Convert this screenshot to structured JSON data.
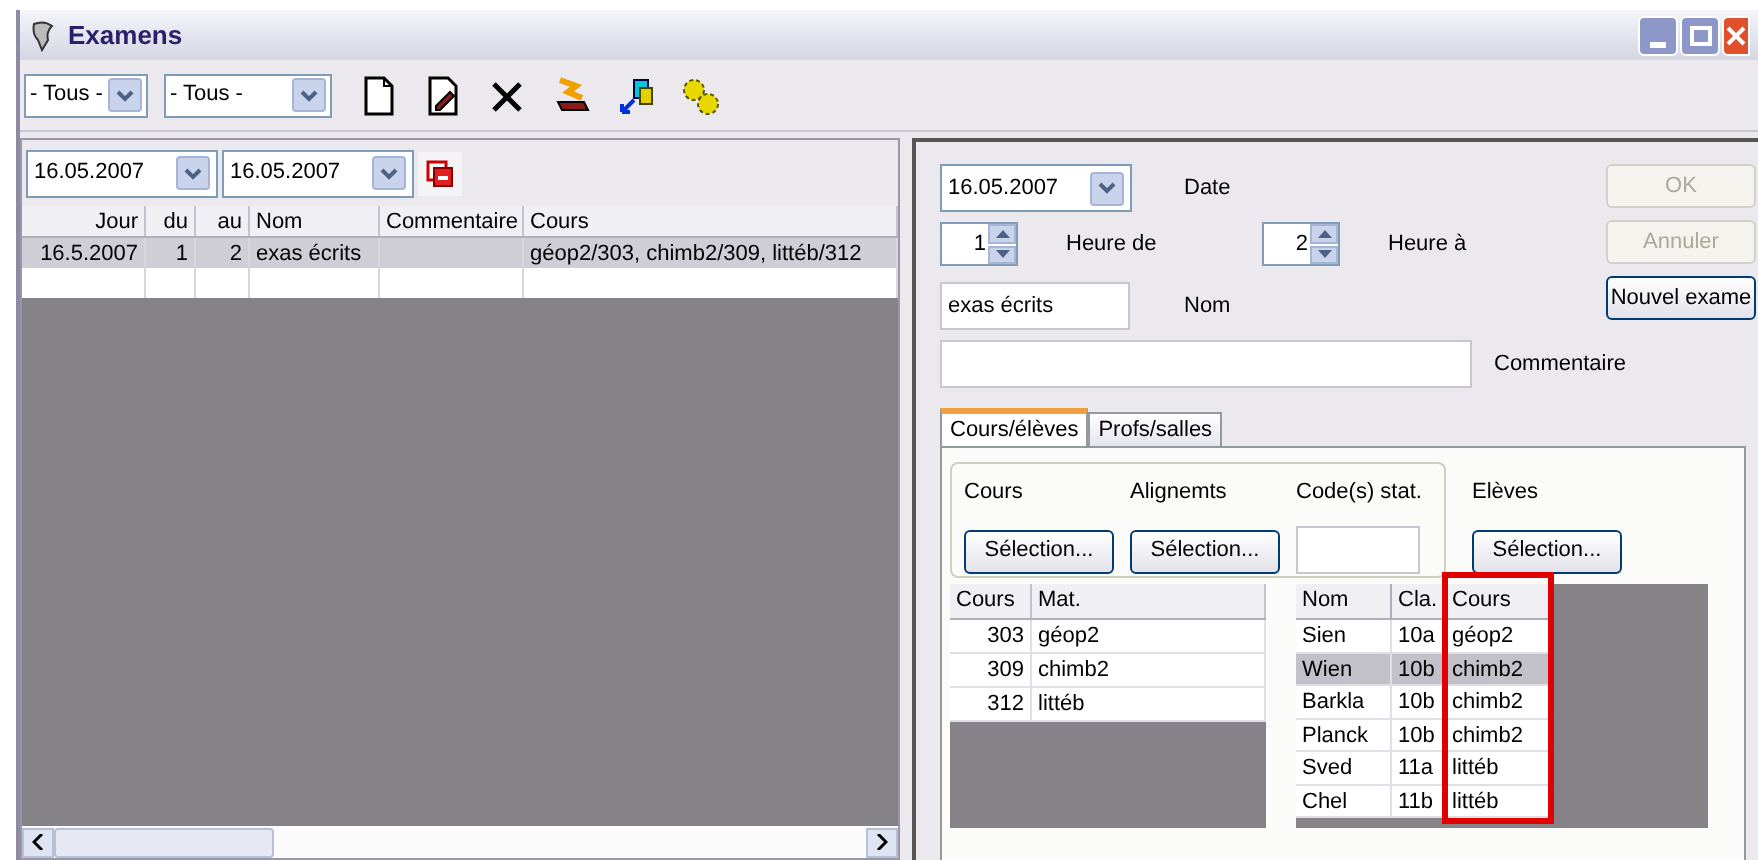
{
  "window": {
    "title": "Examens"
  },
  "toolbar": {
    "filters": [
      {
        "value": "- Tous -"
      },
      {
        "value": "- Tous -"
      }
    ]
  },
  "left": {
    "date_from": "16.05.2007",
    "date_to": "16.05.2007",
    "columns": [
      "Jour",
      "du",
      "au",
      "Nom",
      "Commentaire",
      "Cours"
    ],
    "rows": [
      {
        "cells": [
          "16.5.2007",
          "1",
          "2",
          "exas écrits",
          "",
          "géop2/303, chimb2/309, littéb/312"
        ],
        "selected": true
      }
    ]
  },
  "form": {
    "date": "16.05.2007",
    "date_label": "Date",
    "hour_from": "1",
    "hour_from_label": "Heure de",
    "hour_to": "2",
    "hour_to_label": "Heure à",
    "name": "exas écrits",
    "name_label": "Nom",
    "comment_label": "Commentaire",
    "buttons": [
      {
        "label": "OK",
        "disabled": true
      },
      {
        "label": "Annuler",
        "disabled": true
      },
      {
        "label": "Nouvel exame",
        "disabled": false
      }
    ]
  },
  "tabs": [
    {
      "label": "Cours/élèves",
      "selected": true
    },
    {
      "label": "Profs/salles",
      "selected": false
    }
  ],
  "selection": {
    "groups": [
      {
        "label": "Cours",
        "kind": "button",
        "button": "Sélection..."
      },
      {
        "label": "Alignemts",
        "kind": "button",
        "button": "Sélection..."
      },
      {
        "label": "Code(s) stat.",
        "kind": "input"
      }
    ],
    "students_label": "Elèves",
    "students_button": "Sélection..."
  },
  "courses": {
    "columns": [
      "Cours",
      "Mat."
    ],
    "rows": [
      {
        "cells": [
          "303",
          "géop2"
        ]
      },
      {
        "cells": [
          "309",
          "chimb2"
        ]
      },
      {
        "cells": [
          "312",
          "littéb"
        ]
      }
    ]
  },
  "students": {
    "columns": [
      {
        "label": "Nom",
        "highlighted": false
      },
      {
        "label": "Cla.",
        "highlighted": false
      },
      {
        "label": "Cours",
        "highlighted": true
      }
    ],
    "rows": [
      {
        "cells": [
          "Sien",
          "10a",
          "géop2"
        ],
        "selected": false
      },
      {
        "cells": [
          "Wien",
          "10b",
          "chimb2"
        ],
        "selected": true
      },
      {
        "cells": [
          "Barkla",
          "10b",
          "chimb2"
        ],
        "selected": false
      },
      {
        "cells": [
          "Planck",
          "10b",
          "chimb2"
        ],
        "selected": false
      },
      {
        "cells": [
          "Sved",
          "11a",
          "littéb"
        ],
        "selected": false
      },
      {
        "cells": [
          "Chel",
          "11b",
          "littéb"
        ],
        "selected": false
      }
    ]
  }
}
